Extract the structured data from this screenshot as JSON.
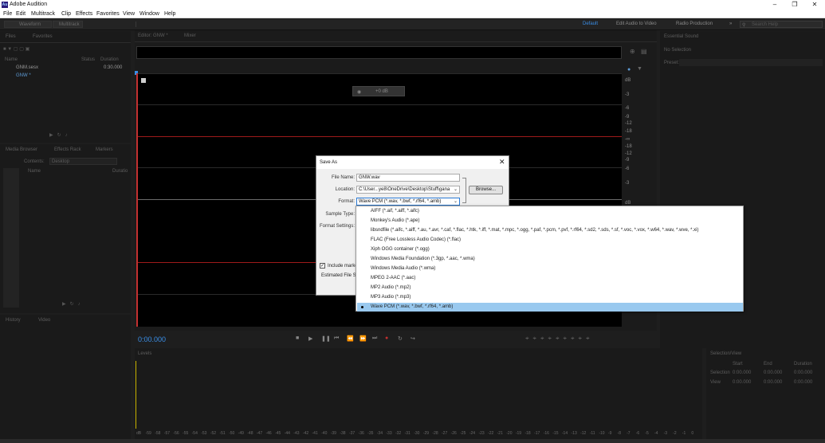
{
  "window": {
    "title": "Adobe Audition",
    "icon_text": "Au"
  },
  "menu": [
    "File",
    "Edit",
    "Multitrack",
    "Clip",
    "Effects",
    "Favorites",
    "View",
    "Window",
    "Help"
  ],
  "toolbar": {
    "waveform": "Waveform",
    "multitrack": "Multitrack",
    "workspaces": [
      "Default",
      "Edit Audio to Video",
      "Radio Production"
    ],
    "workspace_active": "Default",
    "search_placeholder": "Search Help"
  },
  "files_panel": {
    "tabs": [
      "Files",
      "Favorites"
    ],
    "columns": {
      "name": "Name",
      "status": "Status",
      "duration": "Duration"
    },
    "items": [
      {
        "name": "GNM.sesx",
        "duration": "0:30.000"
      },
      {
        "name": "GNW *",
        "duration": ""
      }
    ]
  },
  "media_browser": {
    "tabs": [
      "Media Browser",
      "Effects Rack",
      "Markers"
    ],
    "contents_label": "Contents:",
    "contents_value": "Desktop",
    "column": "Name",
    "column2": "Duratio"
  },
  "bottom_left_tabs": [
    "History",
    "Video"
  ],
  "editor": {
    "tabs": [
      "Editor: GNW *",
      "Mixer"
    ],
    "hud_value": "+0 dB",
    "time": "0:00.000",
    "db_label": "dB",
    "db_scale": [
      "-3",
      "-6",
      "-9",
      "-12",
      "-18",
      "-∞",
      "-18",
      "-12",
      "-9",
      "-6",
      "-3"
    ],
    "db_scale_bottom": "dB"
  },
  "right_panel": {
    "tab": "Essential Sound",
    "no_selection": "No Selection",
    "preset_label": "Preset:"
  },
  "save_as": {
    "title": "Save As",
    "file_name_label": "File Name:",
    "file_name": "GNW.wav",
    "location_label": "Location:",
    "location": "C:\\User...ye8\\OneDrive\\Desktop\\Stuff\\gana",
    "browse": "Browse...",
    "format_label": "Format:",
    "format": "Wave PCM (*.wav, *.bwf, *.rf64, *.amb)",
    "sample_type_label": "Sample Type:",
    "format_settings_label": "Format Settings:",
    "include_markers": "Include marke",
    "estimated_label": "Estimated File S"
  },
  "format_options": [
    "AIFF (*.aif, *.aiff, *.aifc)",
    "Monkey's Audio (*.ape)",
    "libsndfile (*.aifc, *.aiff, *.au, *.avr, *.caf, *.flac, *.htk, *.iff, *.mat, *.mpc, *.ogg, *.paf, *.pcm, *.pvf, *.rf64, *.sd2, *.sds, *.sf, *.voc, *.vox, *.w64, *.wav, *.wve, *.xi)",
    "FLAC (Free Lossless Audio Codec) (*.flac)",
    "Xiph OGG container (*.ogg)",
    "Windows Media Foundation (*.3gp, *.aac, *.wma)",
    "Windows Media Audio (*.wma)",
    "MPEG 2-AAC (*.aac)",
    "MP2 Audio (*.mp2)",
    "MP3 Audio (*.mp3)",
    "Wave PCM (*.wav, *.bwf, *.rf64, *.amb)"
  ],
  "format_selected_index": 10,
  "levels": {
    "tab": "Levels",
    "scale": [
      "dB",
      "-59",
      "-58",
      "-57",
      "-56",
      "-55",
      "-54",
      "-53",
      "-52",
      "-51",
      "-50",
      "-49",
      "-48",
      "-47",
      "-46",
      "-45",
      "-44",
      "-43",
      "-42",
      "-41",
      "-40",
      "-39",
      "-38",
      "-37",
      "-36",
      "-35",
      "-34",
      "-33",
      "-32",
      "-31",
      "-30",
      "-29",
      "-28",
      "-27",
      "-26",
      "-25",
      "-24",
      "-23",
      "-22",
      "-21",
      "-20",
      "-19",
      "-18",
      "-17",
      "-16",
      "-15",
      "-14",
      "-13",
      "-12",
      "-11",
      "-10",
      "-9",
      "-8",
      "-7",
      "-6",
      "-5",
      "-4",
      "-3",
      "-2",
      "-1",
      "0"
    ]
  },
  "selection_view": {
    "tab": "Selection/View",
    "cols": [
      "Start",
      "End",
      "Duration"
    ],
    "rows": [
      {
        "label": "Selection",
        "start": "0:00.000",
        "end": "0:00.000",
        "duration": "0:00.000"
      },
      {
        "label": "View",
        "start": "0:00.000",
        "end": "0:00.000",
        "duration": "0:00.000"
      }
    ]
  },
  "colors": {
    "accent": "#3a8ee6",
    "selection": "#99c9ef",
    "dialog_bg": "#f0f0f0"
  }
}
